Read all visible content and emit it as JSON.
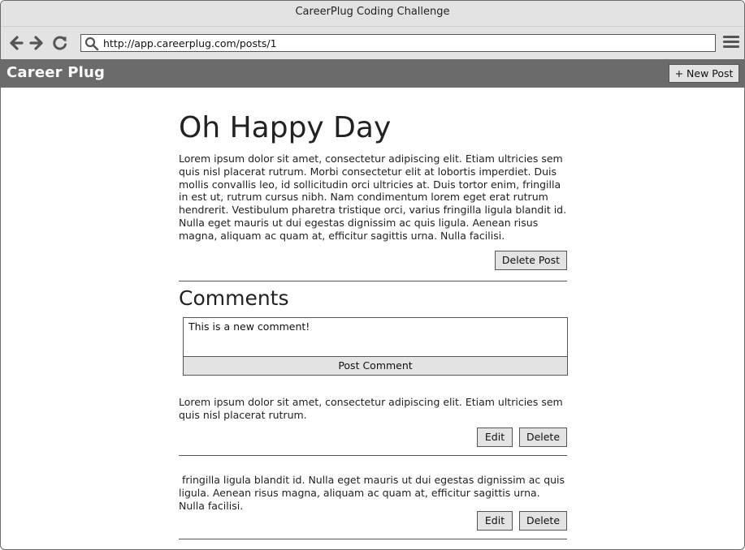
{
  "window": {
    "title": "CareerPlug Coding Challenge"
  },
  "browser": {
    "url": "http://app.careerplug.com/posts/1",
    "icons": [
      "back-arrow-icon",
      "forward-arrow-icon",
      "reload-icon",
      "search-icon",
      "hamburger-menu-icon"
    ]
  },
  "app": {
    "brand": "Career Plug",
    "new_post_label": "+ New Post"
  },
  "post": {
    "title": "Oh Happy Day",
    "body": "Lorem ipsum dolor sit amet, consectetur adipiscing elit. Etiam ultricies sem quis nisl placerat rutrum. Morbi consectetur elit at lobortis imperdiet. Duis mollis convallis leo, id sollicitudin orci ultricies at. Duis tortor enim, fringilla in est ut, rutrum cursus nibh. Nam condimentum lorem eget erat rutrum hendrerit. Vestibulum pharetra tristique orci, varius fringilla ligula blandit id. Nulla eget mauris ut dui egestas dignissim ac quis ligula. Aenean risus magna, aliquam ac quam at, efficitur sagittis urna. Nulla facilisi.",
    "delete_label": "Delete Post"
  },
  "comments": {
    "heading": "Comments",
    "new_comment_value": "This is a new comment!",
    "post_comment_label": "Post Comment",
    "items": [
      {
        "text": "Lorem ipsum dolor sit amet, consectetur adipiscing elit. Etiam ultricies sem quis nisl placerat rutrum.",
        "edit_label": "Edit",
        "delete_label": "Delete"
      },
      {
        "text": " fringilla ligula blandit id. Nulla eget mauris ut dui egestas dignissim ac quis ligula. Aenean risus magna, aliquam ac quam at, efficitur sagittis urna. Nulla facilisi.",
        "edit_label": "Edit",
        "delete_label": "Delete"
      }
    ]
  }
}
